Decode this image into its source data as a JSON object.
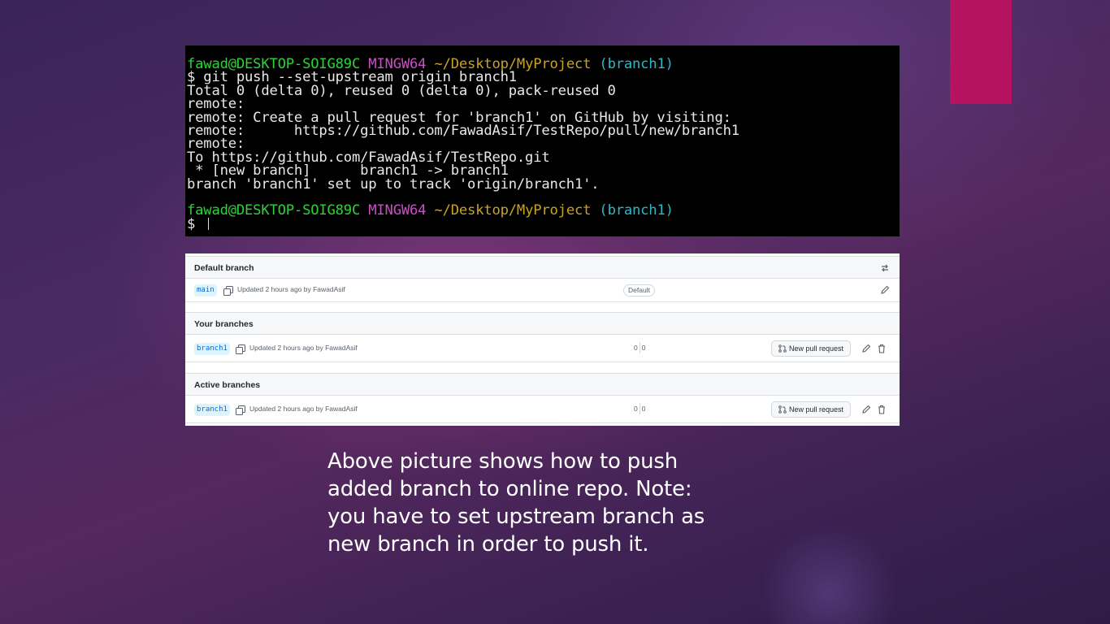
{
  "terminal": {
    "lines": [
      {
        "segments": [
          {
            "text": "fawad@DESKTOP-SOIG89C ",
            "color": "green"
          },
          {
            "text": "MINGW64 ",
            "color": "magenta"
          },
          {
            "text": "~/Desktop/MyProject ",
            "color": "yellow"
          },
          {
            "text": "(branch1)",
            "color": "cyan"
          }
        ]
      },
      {
        "segments": [
          {
            "text": "$ git push --set-upstream origin branch1",
            "color": "white"
          }
        ]
      },
      {
        "segments": [
          {
            "text": "Total 0 (delta 0), reused 0 (delta 0), pack-reused 0",
            "color": "white"
          }
        ]
      },
      {
        "segments": [
          {
            "text": "remote:",
            "color": "white"
          }
        ]
      },
      {
        "segments": [
          {
            "text": "remote: Create a pull request for 'branch1' on GitHub by visiting:",
            "color": "white"
          }
        ]
      },
      {
        "segments": [
          {
            "text": "remote:      https://github.com/FawadAsif/TestRepo/pull/new/branch1",
            "color": "white"
          }
        ]
      },
      {
        "segments": [
          {
            "text": "remote:",
            "color": "white"
          }
        ]
      },
      {
        "segments": [
          {
            "text": "To https://github.com/FawadAsif/TestRepo.git",
            "color": "white"
          }
        ]
      },
      {
        "segments": [
          {
            "text": " * [new branch]      branch1 -> branch1",
            "color": "white"
          }
        ]
      },
      {
        "segments": [
          {
            "text": "branch 'branch1' set up to track 'origin/branch1'.",
            "color": "white"
          }
        ]
      },
      {
        "blank": true
      },
      {
        "segments": [
          {
            "text": "fawad@DESKTOP-SOIG89C ",
            "color": "green"
          },
          {
            "text": "MINGW64 ",
            "color": "magenta"
          },
          {
            "text": "~/Desktop/MyProject ",
            "color": "yellow"
          },
          {
            "text": "(branch1)",
            "color": "cyan"
          }
        ]
      },
      {
        "segments": [
          {
            "text": "$ ",
            "color": "white"
          }
        ],
        "cursor": true
      }
    ]
  },
  "branches": {
    "default_section": {
      "title": "Default branch",
      "branch": "main",
      "updated": "Updated 2 hours ago by FawadAsif",
      "badge": "Default"
    },
    "yours_section": {
      "title": "Your branches",
      "branch": "branch1",
      "updated": "Updated 2 hours ago by FawadAsif",
      "behind": "0",
      "ahead": "0",
      "pr_label": "New pull request"
    },
    "active_section": {
      "title": "Active branches",
      "branch": "branch1",
      "updated": "Updated 2 hours ago by FawadAsif",
      "behind": "0",
      "ahead": "0",
      "pr_label": "New pull request"
    }
  },
  "caption": {
    "lines": [
      "Above picture shows how to push",
      "added branch to online repo. Note:",
      "you have to set upstream branch as",
      "new branch in order to push it."
    ]
  },
  "colors": {
    "accent": "#b5135f",
    "terminal_green": "#2fd13a",
    "terminal_magenta": "#c950c4",
    "terminal_yellow": "#c9a227",
    "terminal_cyan": "#2ab9c4",
    "link_blue": "#0969da"
  }
}
